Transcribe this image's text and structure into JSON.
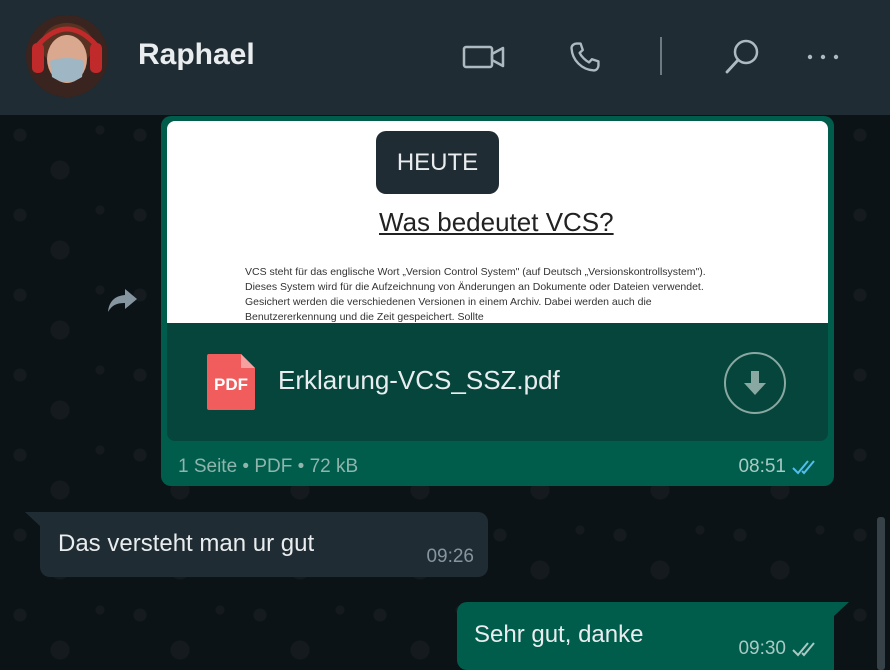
{
  "header": {
    "contact_name": "Raphael",
    "icons": [
      "video-call-icon",
      "voice-call-icon",
      "search-icon",
      "more-options-icon"
    ]
  },
  "date_separator": "HEUTE",
  "pdf_message": {
    "preview_title": "Was bedeutet VCS?",
    "preview_text": "VCS steht für das englische Wort „Version Control System\" (auf Deutsch „Versionskontrollsystem\"). Dieses System wird für die Aufzeichnung von Änderungen an Dokumente oder Dateien verwendet. Gesichert werden die verschiedenen Versionen in einem Archiv. Dabei werden auch die Benutzererkennung und die Zeit gespeichert. Sollte",
    "file_name": "Erklarung-VCS_SSZ.pdf",
    "file_type_badge": "PDF",
    "meta": "1 Seite • PDF • 72 kB",
    "time": "08:51",
    "status": "read"
  },
  "messages": [
    {
      "direction": "incoming",
      "text": "Das versteht man ur gut",
      "time": "09:26"
    },
    {
      "direction": "outgoing",
      "text": "Sehr gut, danke",
      "time": "09:30",
      "status": "delivered"
    }
  ],
  "colors": {
    "header_bg": "#202c33",
    "chat_bg": "#0c1317",
    "outgoing_bubble": "#005c4b",
    "incoming_bubble": "#202c33",
    "read_tick": "#53bdeb",
    "pdf_red": "#f15c5c"
  }
}
